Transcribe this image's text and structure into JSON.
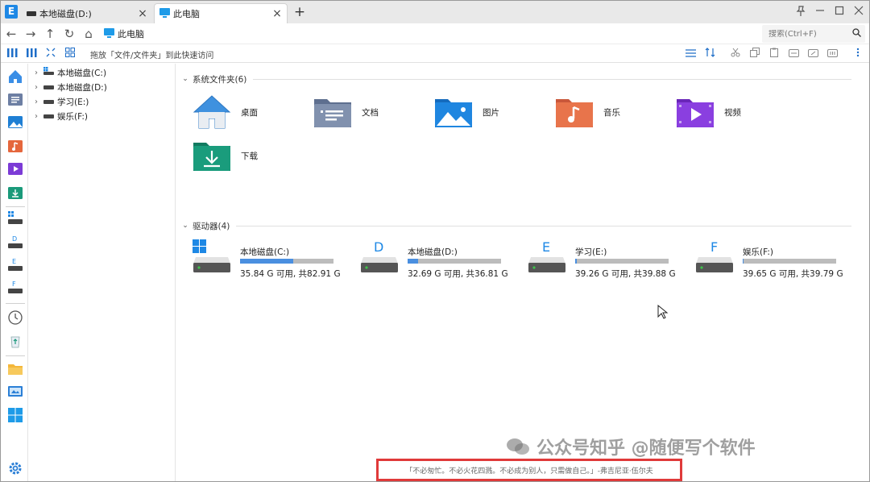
{
  "titlebar": {
    "tabs": [
      {
        "label": "本地磁盘(D:)",
        "close": "×"
      },
      {
        "label": "此电脑",
        "close": "×"
      }
    ],
    "new_tab": "+",
    "app_logo": "E"
  },
  "nav": {
    "back": "←",
    "forward": "→",
    "up": "↑",
    "refresh": "↻",
    "home": "⌂",
    "address": "此电脑",
    "search_placeholder": "搜索(Ctrl+F)"
  },
  "toolbar": {
    "hint": "拖放「文件/文件夹」到此快速访问"
  },
  "tree": {
    "items": [
      {
        "label": "本地磁盘(C:)"
      },
      {
        "label": "本地磁盘(D:)"
      },
      {
        "label": "学习(E:)"
      },
      {
        "label": "娱乐(F:)"
      }
    ]
  },
  "groups": {
    "system_folders": "系统文件夹(6)",
    "drives": "驱动器(4)"
  },
  "folders": [
    {
      "label": "桌面",
      "icon": "desktop-home-icon"
    },
    {
      "label": "文档",
      "icon": "documents-icon"
    },
    {
      "label": "图片",
      "icon": "pictures-icon"
    },
    {
      "label": "音乐",
      "icon": "music-icon"
    },
    {
      "label": "视频",
      "icon": "videos-icon"
    },
    {
      "label": "下载",
      "icon": "downloads-icon"
    }
  ],
  "drives": [
    {
      "name": "本地磁盘(C:)",
      "letter": "",
      "free": "35.84 G 可用, 共82.91 G",
      "used_fraction": 0.568
    },
    {
      "name": "本地磁盘(D:)",
      "letter": "D",
      "free": "32.69 G 可用, 共36.81 G",
      "used_fraction": 0.112
    },
    {
      "name": "学习(E:)",
      "letter": "E",
      "free": "39.26 G 可用, 共39.88 G",
      "used_fraction": 0.016
    },
    {
      "name": "娱乐(F:)",
      "letter": "F",
      "free": "39.65 G 可用, 共39.79 G",
      "used_fraction": 0.004
    }
  ],
  "watermark": "公众号知乎 @随便写个软件",
  "status_quote": "「不必匆忙。不必火花四溅。不必成为别人，只需做自己。」-弗吉尼亚·伍尔夫",
  "colors": {
    "accent": "#1e88e5",
    "drive_bar_fill": "#4a8fe0",
    "drive_bar_track": "#bcbcbc",
    "quote_border": "#e03a3a"
  }
}
